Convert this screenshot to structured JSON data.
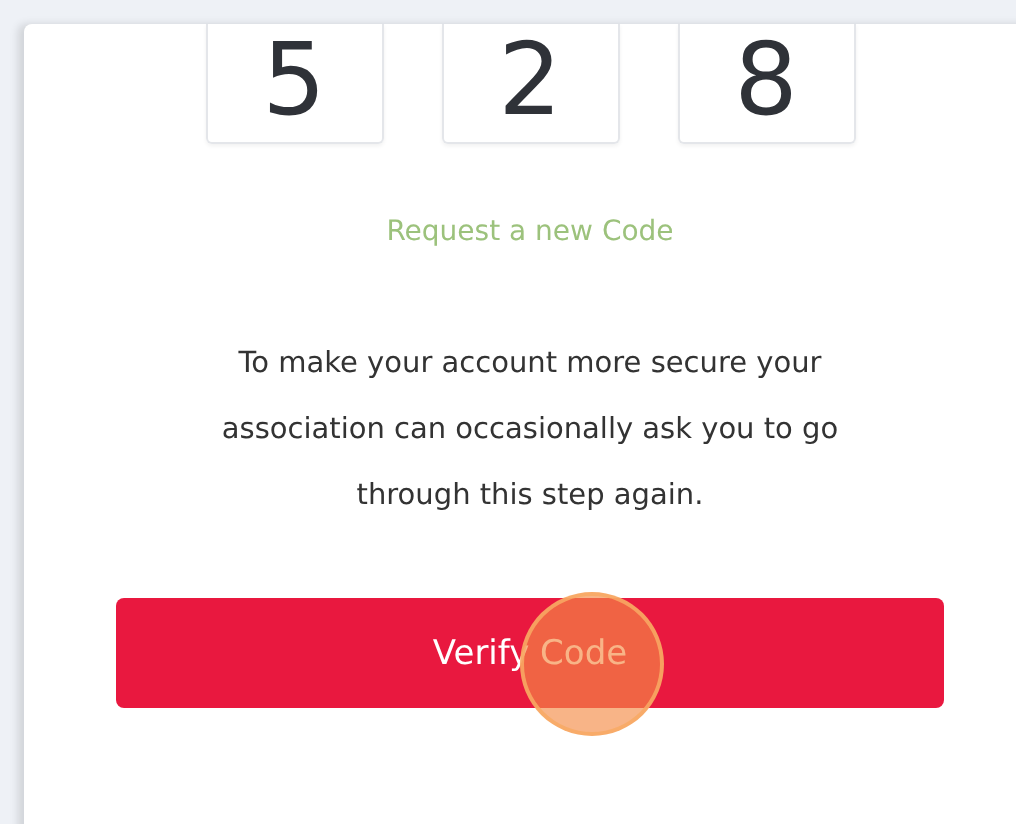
{
  "code_digits": [
    "5",
    "2",
    "8"
  ],
  "request_link": "Request a new Code",
  "info_text": "To make your account more secure your association can occasionally ask you to go through this step again.",
  "verify_button": {
    "label": "Verify Code",
    "clicked": true
  }
}
